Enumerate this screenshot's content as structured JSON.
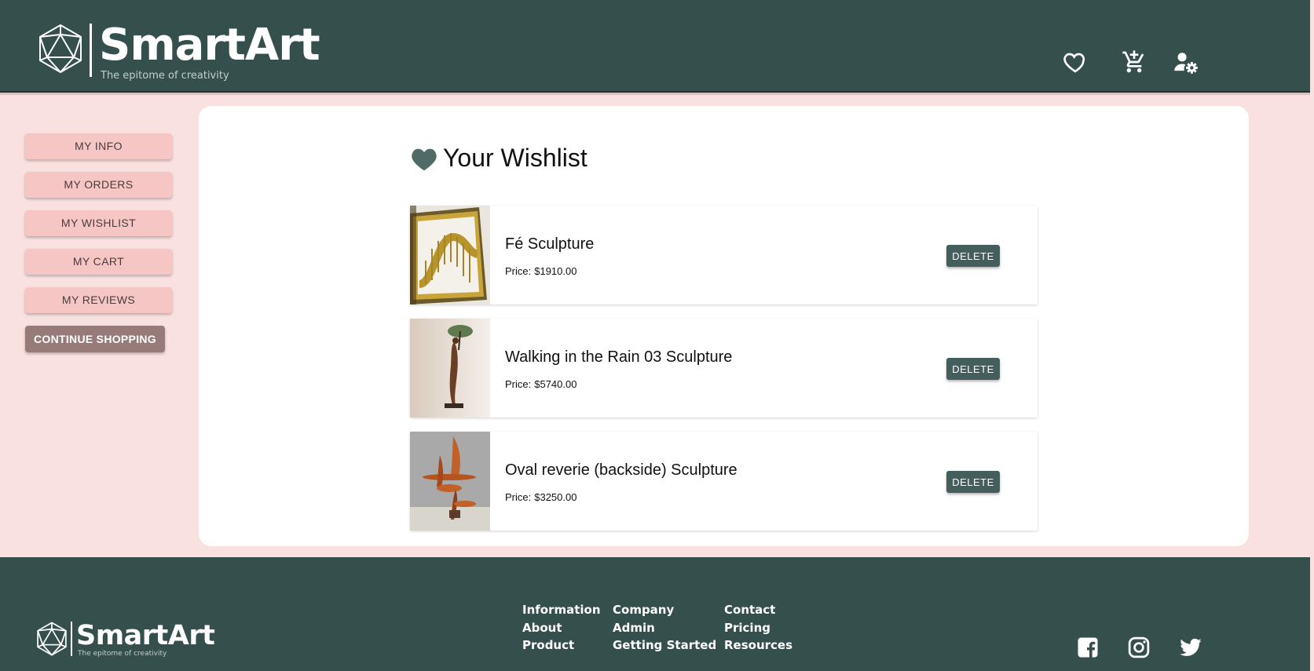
{
  "header": {
    "brand": "SmartArt",
    "tagline": "The epitome of creativity",
    "icons": [
      "heart-outline-icon",
      "cart-add-icon",
      "user-settings-icon"
    ]
  },
  "sidebar": {
    "items": [
      {
        "label": "MY INFO"
      },
      {
        "label": "MY ORDERS"
      },
      {
        "label": "MY WISHLIST"
      },
      {
        "label": "MY CART"
      },
      {
        "label": "MY REVIEWS"
      }
    ],
    "continue_label": "CONTINUE SHOPPING"
  },
  "wishlist": {
    "title": "Your Wishlist",
    "price_label": "Price:",
    "delete_label": "DELETE",
    "items": [
      {
        "name": "Fé Sculpture",
        "price": "$1910.00"
      },
      {
        "name": "Walking in the Rain 03 Sculpture",
        "price": "$5740.00"
      },
      {
        "name": "Oval reverie (backside) Sculpture",
        "price": "$3250.00"
      }
    ]
  },
  "footer": {
    "brand": "SmartArt",
    "tagline": "The epitome of creativity",
    "columns": [
      [
        "Information",
        "About",
        "Product"
      ],
      [
        "Company",
        "Admin",
        "Getting Started"
      ],
      [
        "Contact",
        "Pricing",
        "Resources"
      ]
    ],
    "social": [
      "facebook-icon",
      "instagram-icon",
      "twitter-icon"
    ]
  },
  "colors": {
    "primary": "#344f4c",
    "background": "#f9e1df",
    "side_button": "#f6c6c4",
    "continue_button": "#977b78",
    "delete_button": "#445f5b"
  }
}
